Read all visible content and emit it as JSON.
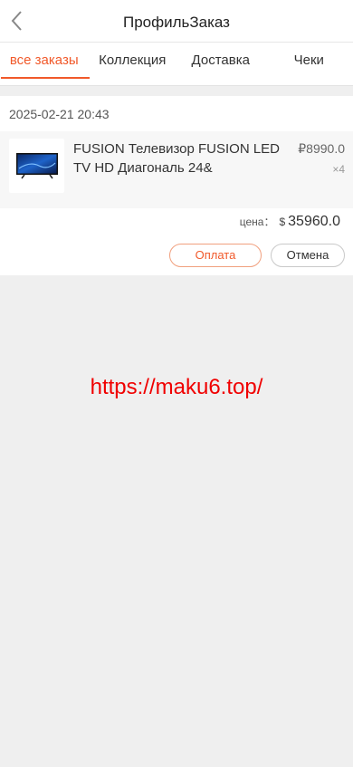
{
  "header": {
    "title": "ПрофильЗаказ",
    "back_icon": "chevron-left-icon"
  },
  "tabs": [
    {
      "label": "все заказы",
      "active": true
    },
    {
      "label": "Коллекция",
      "active": false
    },
    {
      "label": "Доставка",
      "active": false
    },
    {
      "label": "Чеки",
      "active": false
    }
  ],
  "order": {
    "date": "2025-02-21 20:43",
    "product": {
      "image_icon": "tv-thumbnail-icon",
      "title": "FUSION Телевизор FUSION LED TV HD Диагональ 24&",
      "price": "₽8990.0",
      "quantity": "×4"
    },
    "total": {
      "label": "цена：",
      "currency": "$",
      "value": "35960.0"
    },
    "buttons": {
      "pay": "Оплата",
      "cancel": "Отмена"
    }
  },
  "watermark": "https://maku6.top/",
  "colors": {
    "accent": "#f1592a",
    "watermark": "#f00000",
    "background": "#efefef"
  }
}
